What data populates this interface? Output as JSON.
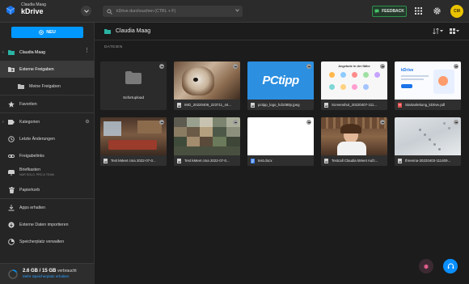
{
  "header": {
    "user_name": "Claudia Maag",
    "app_name": "kDrive",
    "search_placeholder": "kDrive durchsuchen (CTRL + F)",
    "feedback_label": "FEEDBACK",
    "avatar_initials": "CM"
  },
  "sidebar": {
    "new_button": "NEU",
    "items": [
      {
        "label": "Claudia Maag",
        "icon": "drive-icon"
      },
      {
        "label": "Externe Freigaben",
        "icon": "external-share-icon"
      },
      {
        "label": "Meine Freigaben",
        "icon": "my-shares-icon"
      },
      {
        "label": "Favoriten",
        "icon": "star-icon"
      },
      {
        "label": "Kategorien",
        "icon": "tag-icon"
      },
      {
        "label": "Letzte Änderungen",
        "icon": "clock-icon"
      },
      {
        "label": "Freigabelinks",
        "icon": "link-icon"
      },
      {
        "label": "Briefkasten",
        "sublabel": "NUR SOLO, PRO & TEAM",
        "icon": "mailbox-icon"
      },
      {
        "label": "Papierkorb",
        "icon": "trash-icon"
      },
      {
        "label": "Apps erhalten",
        "icon": "download-icon"
      },
      {
        "label": "Externe Daten importieren",
        "icon": "cloud-import-icon"
      },
      {
        "label": "Speicherplatz verwalten",
        "icon": "storage-icon"
      }
    ],
    "storage": {
      "used": "2.6 GB / 15 GB",
      "used_suffix": "verbraucht",
      "link": "Mehr Speicherplatz erhalten"
    }
  },
  "main": {
    "breadcrumb": "Claudia Maag",
    "section_label": "DATEIEN",
    "files": [
      {
        "name": "Sofortupload",
        "kind": "folder"
      },
      {
        "name": "IMG_20220406_223711_44...",
        "kind": "image"
      },
      {
        "name": "pctipp_logo_hd1080p.jpeg",
        "kind": "image"
      },
      {
        "name": "Screenshot_20220407-111...",
        "kind": "image"
      },
      {
        "name": "Startanleitung_kDrive.pdf",
        "kind": "pdf"
      },
      {
        "name": "Test kMeet cma 2022-07-0...",
        "kind": "image"
      },
      {
        "name": "Test kMeet cma 2022-07-0...",
        "kind": "image"
      },
      {
        "name": "test.docx",
        "kind": "doc"
      },
      {
        "name": "Testcall Claudia kMeet Aufz...",
        "kind": "image"
      },
      {
        "name": "threema-20220403-111409...",
        "kind": "image"
      }
    ],
    "pctipp_logo_text": "PCtipp",
    "onboard_heading": "Angebote in der Nähe",
    "kdrive_pdf_title": "kDrive"
  },
  "colors": {
    "accent": "#0098ff",
    "feedback_green": "#2f8f4e",
    "avatar": "#e9c300"
  }
}
